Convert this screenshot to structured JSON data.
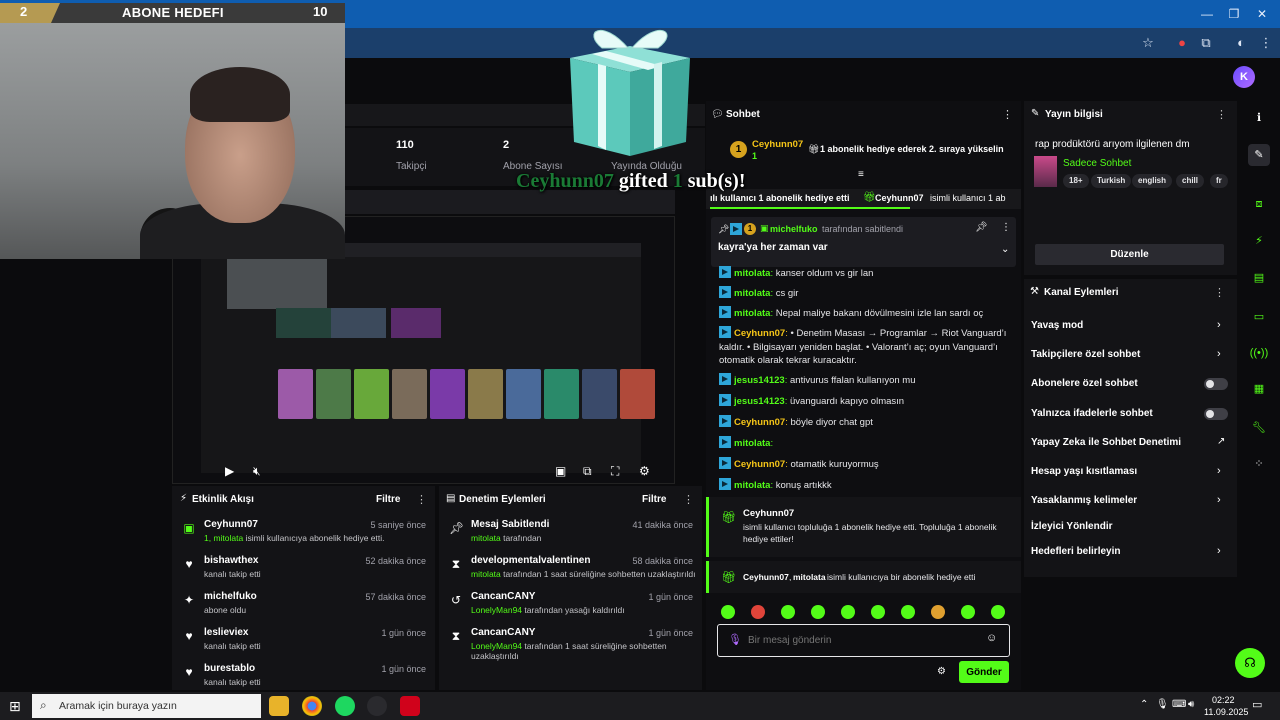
{
  "sub_goal": {
    "current": "2",
    "title": "ABONE HEDEFI",
    "target": "10"
  },
  "stats": {
    "followers_value": "110",
    "followers_label": "Takipçi",
    "subs_value": "2",
    "subs_label": "Abone Sayısı",
    "live_label": "Yayında Olduğu"
  },
  "gift_overlay": {
    "user": "Ceyhunn07",
    "word1": "gifted",
    "count": "1",
    "word2": "sub(s)!"
  },
  "activity_feed": {
    "title": "Etkinlik Akışı",
    "filter": "Filtre",
    "items": [
      {
        "icon": "gift-icon",
        "name": "Ceyhunn07",
        "time": "5 saniye önce",
        "sub_green": "1, mitolata",
        "sub_text": " isimli kullanıcıya abonelik hediye etti."
      },
      {
        "icon": "heart-icon",
        "name": "bishawthex",
        "time": "52 dakika önce",
        "sub_green": "",
        "sub_text": "kanalı takip etti"
      },
      {
        "icon": "sparkle-icon",
        "name": "michelfuko",
        "time": "57 dakika önce",
        "sub_green": "",
        "sub_text": "abone oldu"
      },
      {
        "icon": "heart-icon",
        "name": "leslieviex",
        "time": "1 gün önce",
        "sub_green": "",
        "sub_text": "kanalı takip etti"
      },
      {
        "icon": "heart-icon",
        "name": "burestablo",
        "time": "1 gün önce",
        "sub_green": "",
        "sub_text": "kanalı takip etti"
      }
    ]
  },
  "mod_actions": {
    "title": "Denetim Eylemleri",
    "filter": "Filtre",
    "items": [
      {
        "icon": "pin-icon",
        "name": "Mesaj Sabitlendi",
        "time": "41 dakika önce",
        "sub_green": "mitolata",
        "sub_text": " tarafından"
      },
      {
        "icon": "hourglass-icon",
        "name": "developmentalvalentinen",
        "time": "58 dakika önce",
        "sub_green": "mitolata",
        "sub_text": " tarafından 1 saat süreliğine sohbetten uzaklaştırıldı"
      },
      {
        "icon": "undo-icon",
        "name": "CancanCANY",
        "time": "1 gün önce",
        "sub_green": "LonelyMan94",
        "sub_text": " tarafından yasağı kaldırıldı"
      },
      {
        "icon": "hourglass-icon",
        "name": "CancanCANY",
        "time": "1 gün önce",
        "sub_green": "LonelyMan94",
        "sub_text": " tarafından 1 saat süreliğine sohbetten uzaklaştırıldı"
      }
    ]
  },
  "chat": {
    "title": "Sohbet",
    "top_gifter": {
      "rank": "1",
      "name": "Ceyhunn07",
      "badge": "1",
      "text": "1 abonelik hediye ederek 2. sıraya yükselin"
    },
    "ticker_left": "ılı kullanıcı 1 abonelik hediye etti",
    "ticker_right_user": "Ceyhunn07",
    "ticker_right_text": "isimli kullanıcı 1 ab",
    "pinned": {
      "badge": "1",
      "by_user": "michelfuko",
      "by_text": "tarafından sabitlendi",
      "message": "kayra'ya her zaman var"
    },
    "messages": [
      {
        "user": "mitolata",
        "color": "#53fc18",
        "text": "kanser oldum vs gir lan"
      },
      {
        "user": "mitolata",
        "color": "#53fc18",
        "text": "cs gir"
      },
      {
        "user": "mitolata",
        "color": "#53fc18",
        "text": "Nepal maliye bakanı dövülmesini izle lan sardı oç"
      },
      {
        "user": "Ceyhunn07",
        "color": "#f5c518",
        "text": "• Denetim Masası → Programlar → Riot Vanguard’ı kaldır. • Bilgisayarı yeniden başlat. • Valorant’ı aç; oyun Vanguard’ı otomatik olarak tekrar kuracaktır."
      },
      {
        "user": "jesus14123",
        "color": "#53fc18",
        "text": "antivurus ffalan kullanıyon mu"
      },
      {
        "user": "jesus14123",
        "color": "#53fc18",
        "text": "üvanguardı kapıyo olmasın"
      },
      {
        "user": "Ceyhunn07",
        "color": "#f5c518",
        "text": "böyle diyor chat gpt"
      },
      {
        "user": "mitolata",
        "color": "#53fc18",
        "text": ""
      },
      {
        "user": "Ceyhunn07",
        "color": "#f5c518",
        "text": "otamatik kuruyormuş"
      },
      {
        "user": "mitolata",
        "color": "#53fc18",
        "text": "konuş artıkkk"
      }
    ],
    "gift_event_1": {
      "user": "Ceyhunn07",
      "text": "isimli kullanıcı topluluğa 1 abonelik hediye etti. Topluluğa 1 abonelik hediye ettiler!"
    },
    "gift_event_2": {
      "user1": "Ceyhunn07",
      "user2": "mitolata",
      "text": " isimli kullanıcıya bir abonelik hediye etti"
    },
    "input_placeholder": "Bir mesaj gönderin",
    "send_label": "Gönder"
  },
  "stream_info": {
    "title": "Yayın bilgisi",
    "stream_title": "rap prodüktörü arıyom ilgilenen dm",
    "category": "Sadece Sohbet",
    "tags": [
      "18+",
      "Turkish",
      "english",
      "chill",
      "fr"
    ],
    "edit_label": "Düzenle"
  },
  "channel_actions": {
    "title": "Kanal Eylemleri",
    "items": [
      {
        "label": "Yavaş mod",
        "control": "chevron"
      },
      {
        "label": "Takipçilere özel sohbet",
        "control": "chevron"
      },
      {
        "label": "Abonelere özel sohbet",
        "control": "toggle"
      },
      {
        "label": "Yalnızca ifadelerle sohbet",
        "control": "toggle"
      },
      {
        "label": "Yapay Zeka ile Sohbet Denetimi",
        "control": "external"
      },
      {
        "label": "Hesap yaşı kısıtlaması",
        "control": "chevron"
      },
      {
        "label": "Yasaklanmış kelimeler",
        "control": "chevron"
      },
      {
        "label": "İzleyici Yönlendir",
        "control": "none"
      },
      {
        "label": "Hedefleri belirleyin",
        "control": "chevron"
      }
    ]
  },
  "taskbar": {
    "search_placeholder": "Aramak için buraya yazın",
    "time": "02:22",
    "date": "11.09.2025"
  },
  "colors": {
    "kick_green": "#53fc18",
    "chat_bg": "#0e0e11",
    "panel_bg": "#131316",
    "browser_blue": "#0f5db0"
  }
}
